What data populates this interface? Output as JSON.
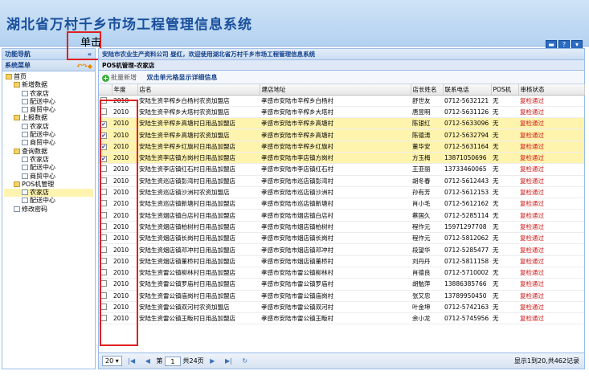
{
  "app": {
    "title": "湖北省万村千乡市场工程管理信息系统"
  },
  "annotation": {
    "label": "单击"
  },
  "sidebar": {
    "header": "功能导航",
    "collapse": "«",
    "menu_title": "系统菜单",
    "tree": [
      {
        "label": "首页",
        "level": 0,
        "type": "folder"
      },
      {
        "label": "新增数据",
        "level": 1,
        "type": "folder"
      },
      {
        "label": "农家店",
        "level": 2,
        "type": "doc"
      },
      {
        "label": "配送中心",
        "level": 2,
        "type": "doc"
      },
      {
        "label": "商贸中心",
        "level": 2,
        "type": "doc"
      },
      {
        "label": "上报数据",
        "level": 1,
        "type": "folder"
      },
      {
        "label": "农家店",
        "level": 2,
        "type": "doc"
      },
      {
        "label": "配送中心",
        "level": 2,
        "type": "doc"
      },
      {
        "label": "商贸中心",
        "level": 2,
        "type": "doc"
      },
      {
        "label": "查询数据",
        "level": 1,
        "type": "folder"
      },
      {
        "label": "农家店",
        "level": 2,
        "type": "doc"
      },
      {
        "label": "配送中心",
        "level": 2,
        "type": "doc"
      },
      {
        "label": "商贸中心",
        "level": 2,
        "type": "doc"
      },
      {
        "label": "POS机管理",
        "level": 1,
        "type": "folder"
      },
      {
        "label": "农家店",
        "level": 2,
        "type": "doc",
        "selected": true
      },
      {
        "label": "配送中心",
        "level": 2,
        "type": "doc"
      },
      {
        "label": "修改密码",
        "level": 1,
        "type": "doc"
      }
    ]
  },
  "main": {
    "welcome": "安陆市农业生产资料公司 昼红，欢迎使用湖北省万村千乡市场工程管理信息系统",
    "tab": "POS机管理-农家店",
    "toolbar": {
      "add_label": "批量新增",
      "hint": "双击单元格显示详细信息"
    },
    "columns": [
      "年度",
      "店名",
      "建店地址",
      "店长姓名",
      "联系电话",
      "POS机",
      "审核状态"
    ],
    "rows": [
      {
        "checked": false,
        "year": "2010",
        "name": "安陆生资辛榨乡白杨村农资加盟店",
        "address": "孝感市安陆市辛榨乡白杨村",
        "manager": "舒世友",
        "phone": "0712-5632121",
        "pos": "无",
        "status": "复检通过"
      },
      {
        "checked": false,
        "year": "2010",
        "name": "安陆生资辛榨乡大塔村农资加盟店",
        "address": "孝感市安陆市辛榨乡大塔村",
        "manager": "唐昱明",
        "phone": "0712-5631126",
        "pos": "无",
        "status": "复检通过"
      },
      {
        "checked": true,
        "year": "2010",
        "name": "安陆生资辛榨乡高塘村日用品加盟店",
        "address": "孝感市安陆市辛榨乡高塘村",
        "manager": "陈银红",
        "phone": "0712-5633096",
        "pos": "无",
        "status": "复检通过"
      },
      {
        "checked": true,
        "year": "2010",
        "name": "安陆生资辛榨乡高塘村农资加盟店",
        "address": "孝感市安陆市辛榨乡高塘村",
        "manager": "陈德涛",
        "phone": "0712-5632794",
        "pos": "无",
        "status": "复检通过"
      },
      {
        "checked": true,
        "year": "2010",
        "name": "安陆生资辛榨乡红旗村日用品加盟店",
        "address": "孝感市安陆市辛榨乡红旗村",
        "manager": "董华安",
        "phone": "0712-5631164",
        "pos": "无",
        "status": "复检通过"
      },
      {
        "checked": true,
        "year": "2010",
        "name": "安陆生资李店镇方岗村日用品加盟店",
        "address": "孝感市安陆市李店镇方岗村",
        "manager": "方玉梅",
        "phone": "13871050696",
        "pos": "无",
        "status": "复检通过"
      },
      {
        "checked": false,
        "year": "2010",
        "name": "安陆生资李店镇红石村日用品加盟店",
        "address": "孝感市安陆市李店镇红石村",
        "manager": "王亚丽",
        "phone": "13733460065",
        "pos": "无",
        "status": "复检通过"
      },
      {
        "checked": false,
        "year": "2010",
        "name": "安陆生资巡店镇彭湾村日用品加盟店",
        "address": "孝感市安陆市巡店镇彭湾村",
        "manager": "胡冬春",
        "phone": "0712-5612443",
        "pos": "无",
        "status": "复检通过"
      },
      {
        "checked": false,
        "year": "2010",
        "name": "安陆生资巡店镇沙洲村农资加盟店",
        "address": "孝感市安陆市巡店镇沙洲村",
        "manager": "孙有芳",
        "phone": "0712-5612153",
        "pos": "无",
        "status": "复检通过"
      },
      {
        "checked": false,
        "year": "2010",
        "name": "安陆生资巡店镇新塘村日用品加盟店",
        "address": "孝感市安陆市巡店镇新塘村",
        "manager": "肖小毛",
        "phone": "0712-5612162",
        "pos": "无",
        "status": "复检通过"
      },
      {
        "checked": false,
        "year": "2010",
        "name": "安陆生资烟店镇白店村日用品加盟店",
        "address": "孝感市安陆市烟店镇白店村",
        "manager": "蔡国久",
        "phone": "0712-5285114",
        "pos": "无",
        "status": "复检通过"
      },
      {
        "checked": false,
        "year": "2010",
        "name": "安陆生资烟店镇柏树村日用品加盟店",
        "address": "孝感市安陆市烟店镇柏树村",
        "manager": "程作元",
        "phone": "15971297708",
        "pos": "无",
        "status": "复检通过"
      },
      {
        "checked": false,
        "year": "2010",
        "name": "安陆生资烟店镇长岗村日用品加盟店",
        "address": "孝感市安陆市烟店镇长岗村",
        "manager": "程作元",
        "phone": "0712-5812062",
        "pos": "无",
        "status": "复检通过"
      },
      {
        "checked": false,
        "year": "2010",
        "name": "安陆生资烟店镇邓冲村日用品加盟店",
        "address": "孝感市安陆市烟店镇邓冲村",
        "manager": "段望华",
        "phone": "0712-5285477",
        "pos": "无",
        "status": "复检通过"
      },
      {
        "checked": false,
        "year": "2010",
        "name": "安陆生资烟店镇董桥村日用品加盟店",
        "address": "孝感市安陆市烟店镇董桥村",
        "manager": "刘丹丹",
        "phone": "0712-5811158",
        "pos": "无",
        "status": "复检通过"
      },
      {
        "checked": false,
        "year": "2010",
        "name": "安陆生资雷公镇柳林村日用品加盟店",
        "address": "孝感市安陆市雷公镇柳林村",
        "manager": "肖德良",
        "phone": "0712-5710002",
        "pos": "无",
        "status": "复检通过"
      },
      {
        "checked": false,
        "year": "2010",
        "name": "安陆生资雷公镇罗庙村日用品加盟店",
        "address": "孝感市安陆市雷公镇罗庙村",
        "manager": "胡勉萍",
        "phone": "13886385766",
        "pos": "无",
        "status": "复检通过"
      },
      {
        "checked": false,
        "year": "2010",
        "name": "安陆生资雷公镇庙岗村日用品加盟店",
        "address": "孝感市安陆市雷公镇庙岗村",
        "manager": "张又忠",
        "phone": "13789950450",
        "pos": "无",
        "status": "复检通过"
      },
      {
        "checked": false,
        "year": "2010",
        "name": "安陆生资雷公镇双河村农资加盟店",
        "address": "孝感市安陆市雷公镇双河村",
        "manager": "叶金坤",
        "phone": "0712-5742163",
        "pos": "无",
        "status": "复检通过"
      },
      {
        "checked": false,
        "year": "2010",
        "name": "安陆生资雷公镇王畈村日用品加盟店",
        "address": "孝感市安陆市雷公镇王畈村",
        "manager": "余小龙",
        "phone": "0712-5745956",
        "pos": "无",
        "status": "复检通过"
      }
    ]
  },
  "pager": {
    "page_size": "20",
    "page_prefix": "第",
    "page": "1",
    "page_suffix": "共24页",
    "summary": "显示1到20,共462记录"
  }
}
